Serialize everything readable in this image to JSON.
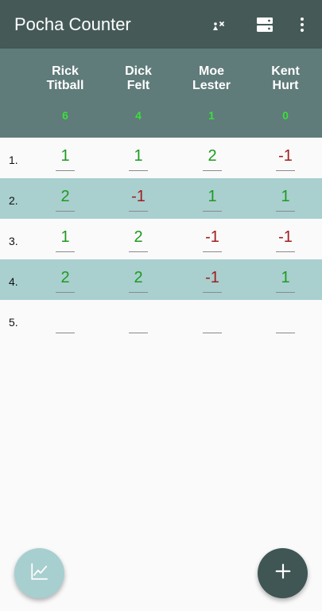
{
  "app": {
    "title": "Pocha Counter"
  },
  "icons": {
    "reset": "clear-players-icon",
    "layout": "table-layout-icon",
    "menu": "overflow-menu-icon",
    "chart": "chart-icon",
    "add": "add-icon"
  },
  "colors": {
    "appbar": "#455a57",
    "header": "#5f7b7a",
    "row_alt": "#a9cfcf",
    "positive": "#1d9b1d",
    "negative": "#a31d1d",
    "total": "#39e03a"
  },
  "players": [
    {
      "first": "Rick",
      "last": "Titball",
      "total": "6"
    },
    {
      "first": "Dick",
      "last": "Felt",
      "total": "4"
    },
    {
      "first": "Moe",
      "last": "Lester",
      "total": "1"
    },
    {
      "first": "Kent",
      "last": "Hurt",
      "total": "0"
    }
  ],
  "rounds": [
    {
      "label": "1.",
      "scores": [
        "1",
        "1",
        "2",
        "-1"
      ]
    },
    {
      "label": "2.",
      "scores": [
        "2",
        "-1",
        "1",
        "1"
      ]
    },
    {
      "label": "3.",
      "scores": [
        "1",
        "2",
        "-1",
        "-1"
      ]
    },
    {
      "label": "4.",
      "scores": [
        "2",
        "2",
        "-1",
        "1"
      ]
    },
    {
      "label": "5.",
      "scores": [
        "",
        "",
        "",
        ""
      ]
    }
  ]
}
